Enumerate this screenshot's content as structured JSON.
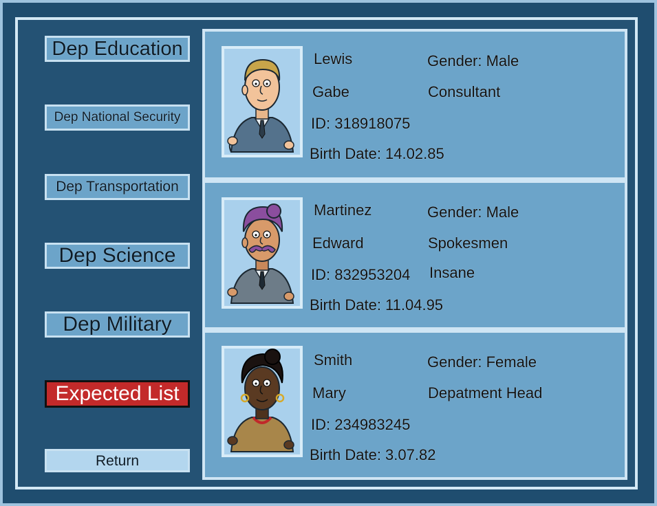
{
  "sidebar": {
    "buttons": [
      {
        "label": "Dep Education"
      },
      {
        "label": "Dep National Security"
      },
      {
        "label": "Dep Transportation"
      },
      {
        "label": "Dep Science"
      },
      {
        "label": "Dep Military"
      },
      {
        "label": "Expected List"
      },
      {
        "label": "Return"
      }
    ]
  },
  "people": [
    {
      "surname": "Lewis",
      "first_name": "Gabe",
      "id_text": "ID: 318918075",
      "birth_text": "Birth Date: 14.02.85",
      "gender_text": "Gender: Male",
      "role": "Consultant",
      "extra": ""
    },
    {
      "surname": "Martinez",
      "first_name": "Edward",
      "id_text": "ID: 832953204",
      "birth_text": "Birth Date: 11.04.95",
      "gender_text": "Gender: Male",
      "role": "Spokesmen",
      "extra": "Insane"
    },
    {
      "surname": "Smith",
      "first_name": "Mary",
      "id_text": "ID: 234983245",
      "birth_text": "Birth Date: 3.07.82",
      "gender_text": "Gender: Female",
      "role": "Depatment Head",
      "extra": ""
    }
  ],
  "colors": {
    "background": "#1f4d6f",
    "panel": "#6ca4c9",
    "border": "#cfe5f4",
    "highlight_button": "#c32a2a"
  }
}
